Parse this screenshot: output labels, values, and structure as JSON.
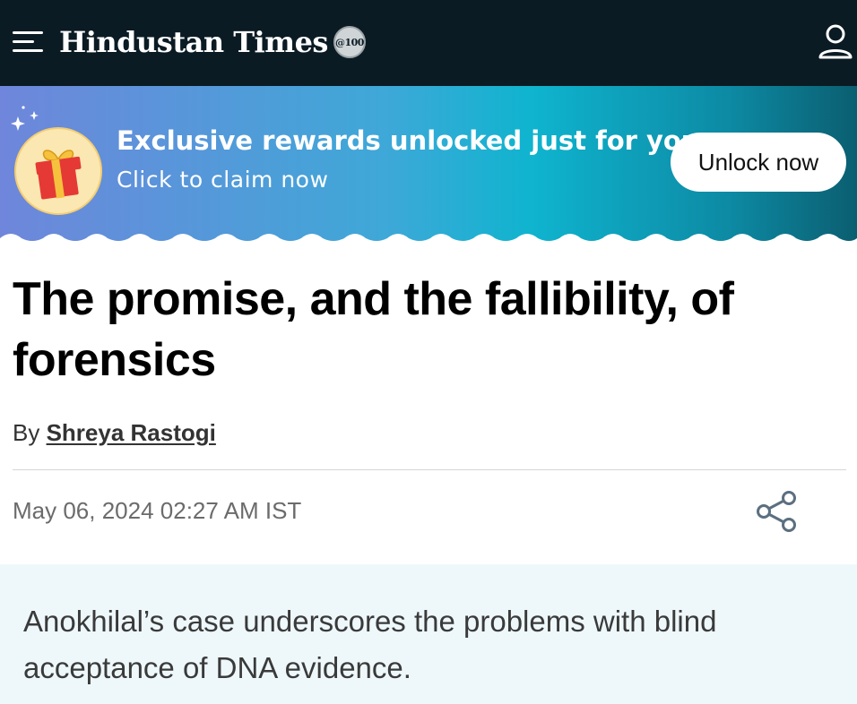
{
  "header": {
    "brand": "Hindustan Times",
    "seal": "@100"
  },
  "promo": {
    "title": "Exclusive rewards unlocked just for you,",
    "subtitle": "Click to claim now",
    "button_label": "Unlock now"
  },
  "article": {
    "headline": "The promise, and the fallibility, of forensics",
    "by_prefix": "By",
    "author": "Shreya Rastogi",
    "timestamp": "May 06, 2024 02:27 AM IST",
    "summary": "Anokhilal’s case underscores the problems with blind acceptance of DNA evidence."
  },
  "icons": {
    "menu": "hamburger-menu-icon",
    "user": "user-profile-icon",
    "gift": "gift-box-icon",
    "sparkles": "sparkles-icon",
    "share": "share-icon"
  },
  "colors": {
    "header_bg": "#0b1b24",
    "promo_gradient_start": "#6f86db",
    "promo_gradient_end": "#0b5e70",
    "summary_bg": "#eef8fb"
  }
}
